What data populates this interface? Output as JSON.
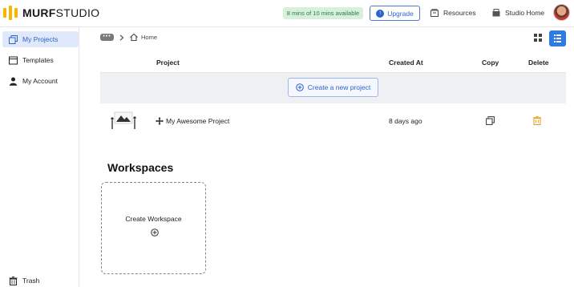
{
  "app": {
    "brand_bold": "MURF",
    "brand_light": "STUDIO",
    "usage": "8 mins of 10 mins available",
    "upgrade": "Upgrade",
    "resources": "Resources",
    "studio_home": "Studio Home"
  },
  "sidebar": {
    "items": [
      {
        "label": "My Projects",
        "icon": "projects-icon",
        "active": true
      },
      {
        "label": "Templates",
        "icon": "templates-icon"
      },
      {
        "label": "My Account",
        "icon": "account-icon"
      }
    ],
    "trash": "Trash"
  },
  "breadcrumb": {
    "more": "•••",
    "home": "Home"
  },
  "table": {
    "columns": {
      "project": "Project",
      "created_at": "Created At",
      "copy": "Copy",
      "delete": "Delete"
    },
    "create_label": "Create a new project",
    "rows": [
      {
        "name": "My Awesome Project",
        "created": "8 days ago"
      }
    ]
  },
  "workspaces": {
    "title": "Workspaces",
    "create_label": "Create Workspace"
  },
  "colors": {
    "accent": "#2e63c8",
    "brand": "#f5b800",
    "delete": "#f0a020",
    "usage_bg": "#d7f0dc"
  }
}
